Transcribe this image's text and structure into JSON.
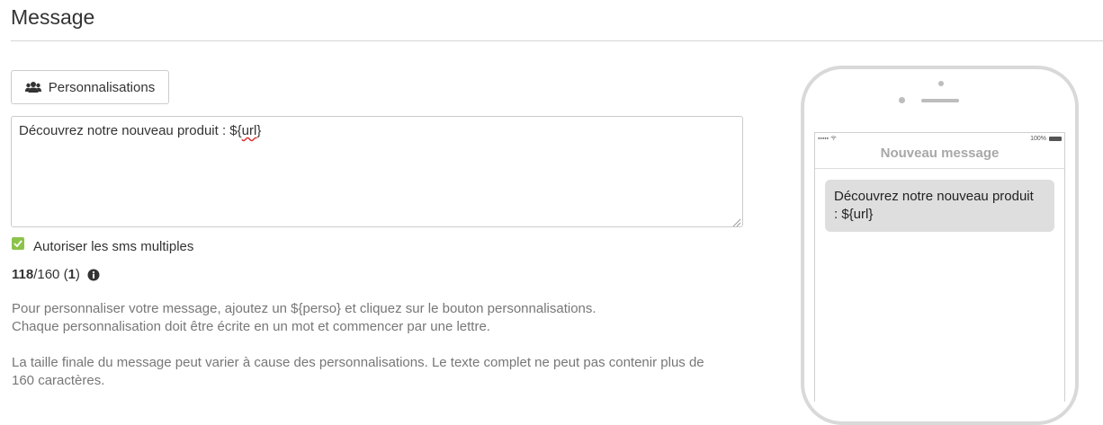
{
  "header": {
    "title": "Message"
  },
  "toolbar": {
    "personalisations_label": "Personnalisations",
    "personalisations_icon": "users-icon"
  },
  "editor": {
    "text_prefix": "Découvrez notre nouveau produit : ${",
    "text_spell": "url",
    "text_suffix": "}"
  },
  "options": {
    "multi_sms_label": "Autoriser les sms multiples",
    "multi_sms_checked": true,
    "check_color": "#8bc34a"
  },
  "counter": {
    "used": "118",
    "max": "/160 (",
    "parts": "1",
    "close": ")",
    "info_icon": "info-icon"
  },
  "help": {
    "line1": "Pour personnaliser votre message, ajoutez un ${perso} et cliquez sur le bouton personnalisations.",
    "line2": "Chaque personnalisation doit être écrite en un mot et commencer par une lettre.",
    "line3": "La taille finale du message peut varier à cause des personnalisations. Le texte complet ne peut pas contenir plus de",
    "line4": "160 caractères."
  },
  "phone": {
    "status_signal": "●●●●●",
    "status_battery_text": "100%",
    "screen_title": "Nouveau message",
    "bubble_line1": "Découvrez notre nouveau produit",
    "bubble_line2": ": ${url}"
  }
}
